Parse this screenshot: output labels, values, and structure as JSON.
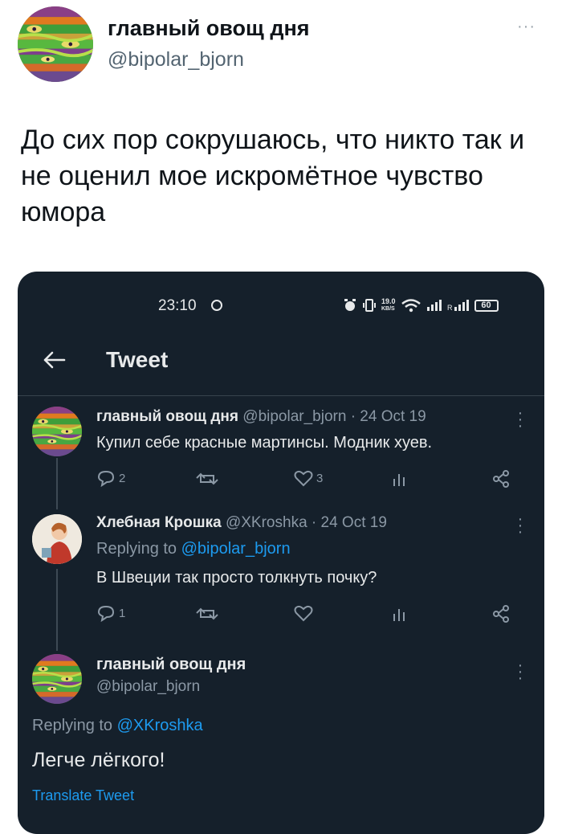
{
  "outer": {
    "display_name": "главный овощ дня",
    "handle": "@bipolar_bjorn",
    "more": "···",
    "text": "До сих пор сокрушаюсь, что никто так и не оценил мое искромётное чувство юмора"
  },
  "screenshot": {
    "status": {
      "time": "23:10",
      "speed": "19.0",
      "speed_unit": "KB/S",
      "battery": "60"
    },
    "toolbar": {
      "title": "Tweet"
    },
    "tweets": [
      {
        "name": "главный овощ дня",
        "meta": "@bipolar_bjorn · 24 Oct 19",
        "text": "Купил себе красные мартинсы. Модник хуев.",
        "replies": "2",
        "likes": "3"
      },
      {
        "name": "Хлебная Крошка",
        "meta": "@XKroshka · 24 Oct 19",
        "replying_prefix": "Replying to",
        "replying_to": "@bipolar_bjorn",
        "text": "В Швеции так просто толкнуть почку?",
        "replies": "1",
        "likes": ""
      }
    ],
    "focused": {
      "name": "главный овощ дня",
      "handle": "@bipolar_bjorn",
      "replying_prefix": "Replying to",
      "replying_to": "@XKroshka",
      "text": "Легче лёгкого!",
      "translate": "Translate Tweet"
    }
  },
  "colors": {
    "dark_bg": "#15202b",
    "accent": "#1d9bf0",
    "muted": "#8b98a5"
  }
}
